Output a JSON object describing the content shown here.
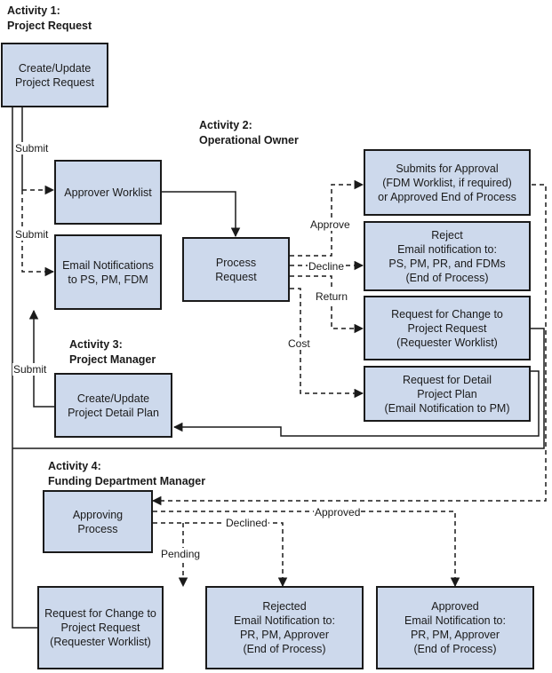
{
  "activities": {
    "a1": {
      "title": "Activity 1:",
      "subtitle": "Project Request"
    },
    "a2": {
      "title": "Activity 2:",
      "subtitle": "Operational Owner"
    },
    "a3": {
      "title": "Activity 3:",
      "subtitle": "Project Manager"
    },
    "a4": {
      "title": "Activity 4:",
      "subtitle": "Funding Department Manager"
    }
  },
  "boxes": {
    "create_request": "Create/Update\nProject Request",
    "approver_worklist": "Approver Worklist",
    "email_notifications": "Email Notifications\nto PS, PM, FDM",
    "process_request": "Process\nRequest",
    "submits_for_approval": "Submits for Approval\n(FDM Worklist, if required)\nor Approved End of Process",
    "reject": "Reject\nEmail notification to:\nPS, PM, PR, and FDMs\n(End of Process)",
    "request_change_1": "Request for Change to\nProject Request\n(Requester Worklist)",
    "request_detail_plan": "Request for Detail\nProject Plan\n(Email Notification to PM)",
    "create_detail_plan": "Create/Update\nProject Detail Plan",
    "approving_process": "Approving\nProcess",
    "request_change_2": "Request for Change to\nProject Request\n(Requester Worklist)",
    "rejected": "Rejected\nEmail Notification to:\nPR, PM, Approver\n(End of Process)",
    "approved": "Approved\nEmail Notification to:\nPR, PM, Approver\n(End of Process)"
  },
  "labels": {
    "submit_1": "Submit",
    "submit_2": "Submit",
    "submit_3": "Submit",
    "approve": "Approve",
    "decline": "Decline",
    "return": "Return",
    "cost": "Cost",
    "approved": "Approved",
    "declined": "Declined",
    "pending": "Pending"
  },
  "colors": {
    "box_fill": "#cdd9ec",
    "line": "#1a1a1a"
  }
}
